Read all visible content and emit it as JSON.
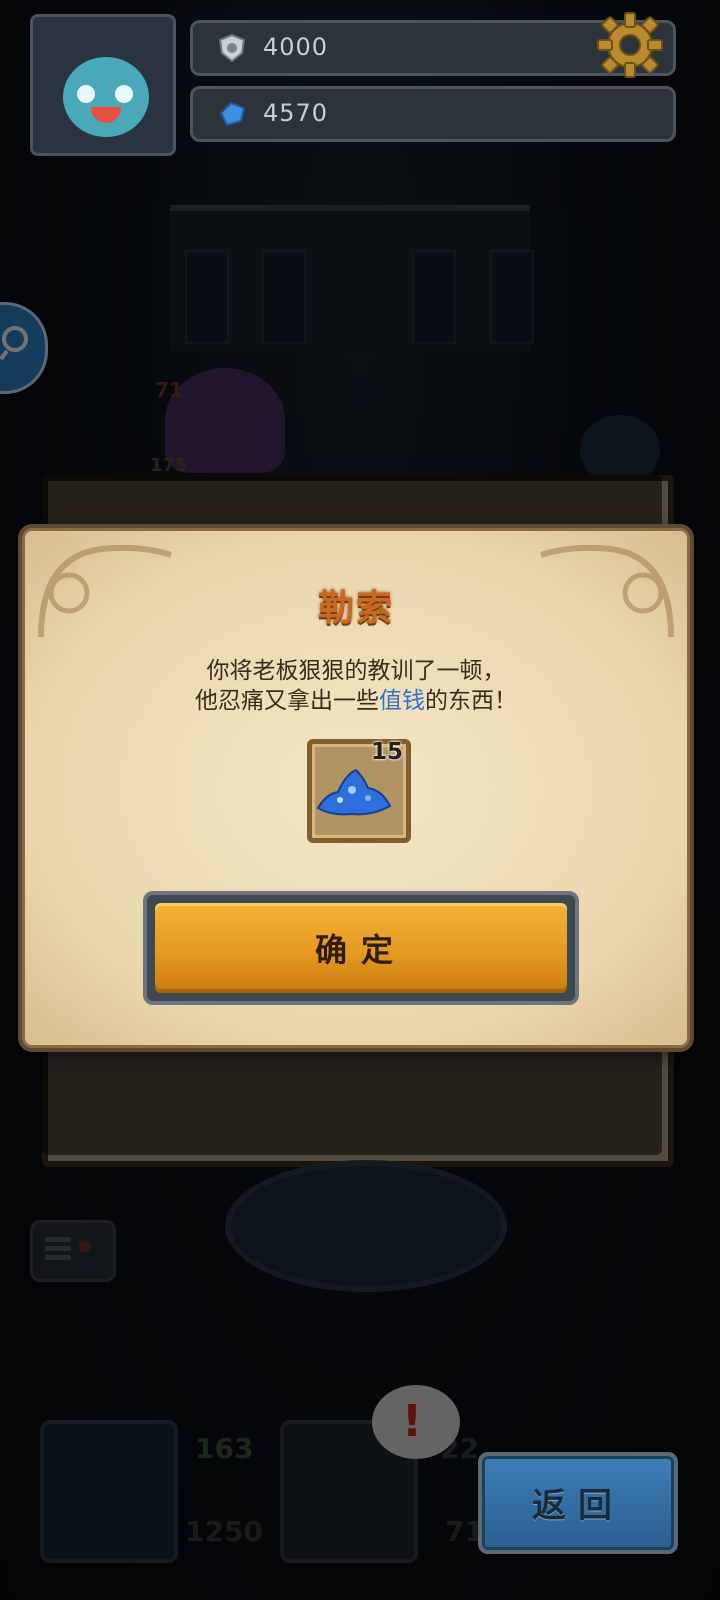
{
  "hud": {
    "currency1": "4000",
    "currency2": "4570",
    "icons": {
      "currency1": "shield-coin-icon",
      "currency2": "blue-gem-icon",
      "settings": "gear-icon"
    }
  },
  "background": {
    "ghost_level": "71",
    "ghost_sub": "175",
    "tile_left_value": "163",
    "tile_left_sub": "1250",
    "tile_right_value": "22",
    "tile_right_sub": "71"
  },
  "dialog": {
    "title": "勒索",
    "line1": "你将老板狠狠的教训了一顿，",
    "line2_before": "他忍痛又拿出一些",
    "line2_highlight": "值钱",
    "line2_after": "的东西！",
    "reward_count": "15",
    "confirm_label": "确定",
    "colors": {
      "title": "#c9681f",
      "highlight": "#3a6fc9",
      "button": "#e59a21"
    }
  },
  "return_button": {
    "label": "返回"
  }
}
